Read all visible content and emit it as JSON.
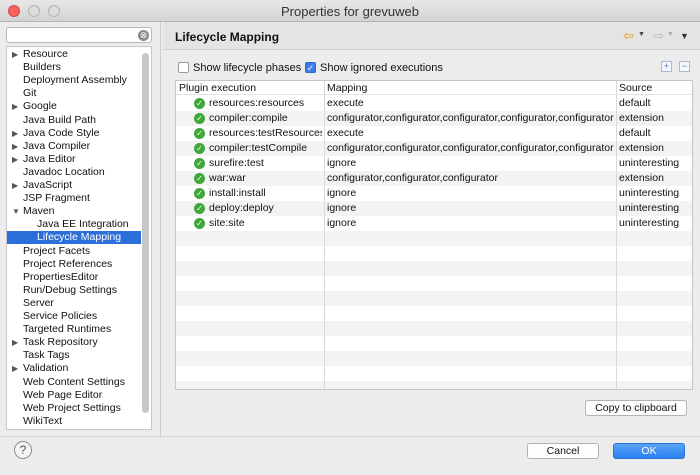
{
  "window": {
    "title": "Properties for grevuweb"
  },
  "filter": {
    "value": "",
    "placeholder": "",
    "clear_icon": "⊗"
  },
  "tree": {
    "items": [
      {
        "label": "Resource",
        "expandable": true,
        "expanded": false,
        "level": 0
      },
      {
        "label": "Builders",
        "expandable": false,
        "level": 0
      },
      {
        "label": "Deployment Assembly",
        "expandable": false,
        "level": 0
      },
      {
        "label": "Git",
        "expandable": false,
        "level": 0
      },
      {
        "label": "Google",
        "expandable": true,
        "expanded": false,
        "level": 0
      },
      {
        "label": "Java Build Path",
        "expandable": false,
        "level": 0
      },
      {
        "label": "Java Code Style",
        "expandable": true,
        "expanded": false,
        "level": 0
      },
      {
        "label": "Java Compiler",
        "expandable": true,
        "expanded": false,
        "level": 0
      },
      {
        "label": "Java Editor",
        "expandable": true,
        "expanded": false,
        "level": 0
      },
      {
        "label": "Javadoc Location",
        "expandable": false,
        "level": 0
      },
      {
        "label": "JavaScript",
        "expandable": true,
        "expanded": false,
        "level": 0
      },
      {
        "label": "JSP Fragment",
        "expandable": false,
        "level": 0
      },
      {
        "label": "Maven",
        "expandable": true,
        "expanded": true,
        "level": 0
      },
      {
        "label": "Java EE Integration",
        "expandable": false,
        "level": 1
      },
      {
        "label": "Lifecycle Mapping",
        "expandable": false,
        "level": 1,
        "selected": true
      },
      {
        "label": "Project Facets",
        "expandable": false,
        "level": 0
      },
      {
        "label": "Project References",
        "expandable": false,
        "level": 0
      },
      {
        "label": "PropertiesEditor",
        "expandable": false,
        "level": 0
      },
      {
        "label": "Run/Debug Settings",
        "expandable": false,
        "level": 0
      },
      {
        "label": "Server",
        "expandable": false,
        "level": 0
      },
      {
        "label": "Service Policies",
        "expandable": false,
        "level": 0
      },
      {
        "label": "Targeted Runtimes",
        "expandable": false,
        "level": 0
      },
      {
        "label": "Task Repository",
        "expandable": true,
        "expanded": false,
        "level": 0
      },
      {
        "label": "Task Tags",
        "expandable": false,
        "level": 0
      },
      {
        "label": "Validation",
        "expandable": true,
        "expanded": false,
        "level": 0
      },
      {
        "label": "Web Content Settings",
        "expandable": false,
        "level": 0
      },
      {
        "label": "Web Page Editor",
        "expandable": false,
        "level": 0
      },
      {
        "label": "Web Project Settings",
        "expandable": false,
        "level": 0
      },
      {
        "label": "WikiText",
        "expandable": false,
        "level": 0
      }
    ]
  },
  "page": {
    "title": "Lifecycle Mapping",
    "back_icon": "⇦",
    "forward_icon": "⇨",
    "dropdown_icon": "▼",
    "view_menu_icon": "▼"
  },
  "options": {
    "show_phases": {
      "label": "Show lifecycle phases",
      "checked": false
    },
    "show_ignored": {
      "label": "Show ignored executions",
      "checked": true
    },
    "expand_all_icon": "+",
    "collapse_all_icon": "−"
  },
  "table": {
    "columns": [
      "Plugin execution",
      "Mapping",
      "Source"
    ],
    "rows": [
      {
        "plugin": "resources:resources",
        "mapping": "execute",
        "source": "default"
      },
      {
        "plugin": "compiler:compile",
        "mapping": "configurator,configurator,configurator,configurator,configurator",
        "source": "extension"
      },
      {
        "plugin": "resources:testResources",
        "mapping": "execute",
        "source": "default"
      },
      {
        "plugin": "compiler:testCompile",
        "mapping": "configurator,configurator,configurator,configurator,configurator",
        "source": "extension"
      },
      {
        "plugin": "surefire:test",
        "mapping": "ignore",
        "source": "uninteresting"
      },
      {
        "plugin": "war:war",
        "mapping": "configurator,configurator,configurator",
        "source": "extension"
      },
      {
        "plugin": "install:install",
        "mapping": "ignore",
        "source": "uninteresting"
      },
      {
        "plugin": "deploy:deploy",
        "mapping": "ignore",
        "source": "uninteresting"
      },
      {
        "plugin": "site:site",
        "mapping": "ignore",
        "source": "uninteresting"
      }
    ],
    "ok_icon": "✓"
  },
  "buttons": {
    "copy": "Copy to clipboard",
    "cancel": "Cancel",
    "ok": "OK",
    "help": "?"
  },
  "colors": {
    "selection": "#2c6fd8",
    "ok_icon": "#3fa83a",
    "primary_button": "#2a7ff0",
    "close_button": "#fc605c"
  }
}
